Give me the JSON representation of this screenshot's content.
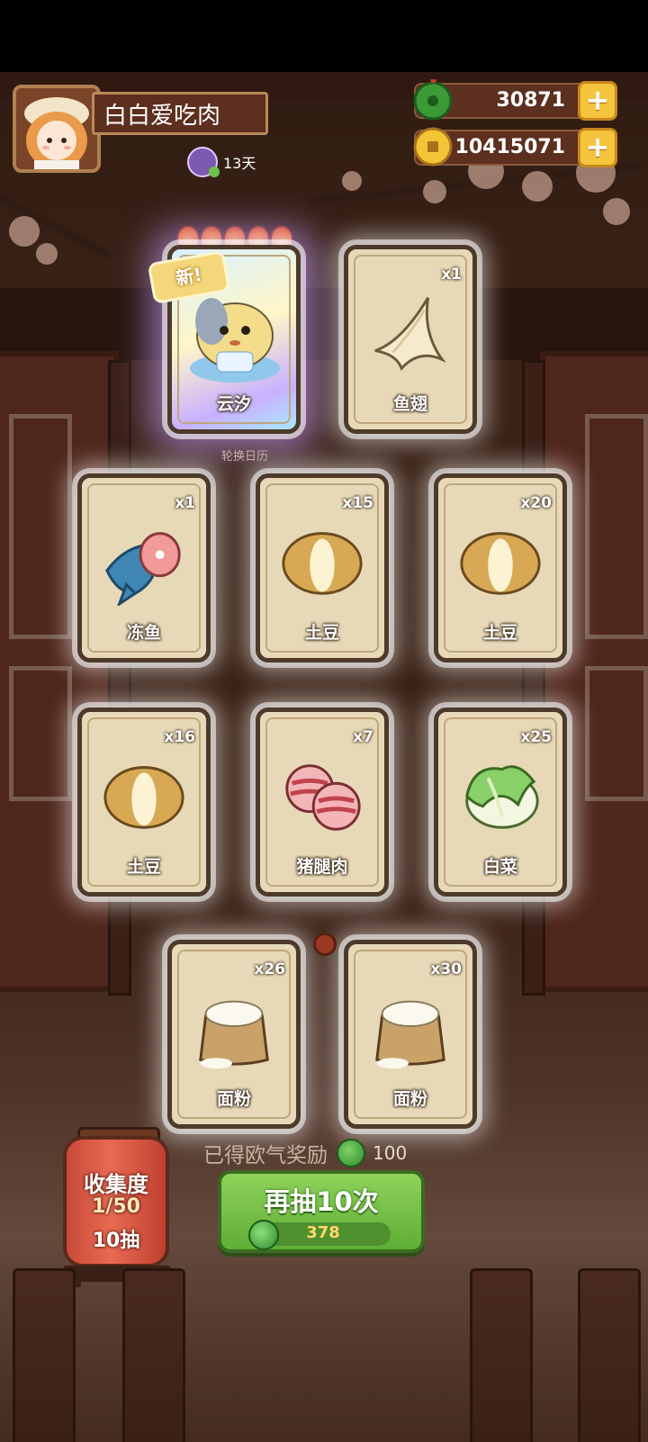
{
  "player": {
    "name": "白白爱吃肉",
    "days": "13天",
    "avatar_icon": "girl-avatar-icon"
  },
  "currencies": {
    "jade": {
      "value": "30871",
      "icon": "jade-icon",
      "add_label": "+"
    },
    "coin": {
      "value": "10415071",
      "icon": "coin-icon",
      "add_label": "+"
    }
  },
  "background_label": "轮换日历",
  "cards": [
    {
      "name": "云汐",
      "qty": "",
      "type": "character",
      "is_new": true,
      "new_label": "新!",
      "stars": 5,
      "icon": "yunxi-character-icon"
    },
    {
      "name": "鱼翅",
      "qty": "x1",
      "type": "ingredient",
      "icon": "shark-fin-icon"
    },
    {
      "name": "冻鱼",
      "qty": "x1",
      "type": "ingredient",
      "icon": "frozen-fish-icon"
    },
    {
      "name": "土豆",
      "qty": "x15",
      "type": "ingredient",
      "icon": "potato-icon"
    },
    {
      "name": "土豆",
      "qty": "x20",
      "type": "ingredient",
      "icon": "potato-icon"
    },
    {
      "name": "土豆",
      "qty": "x16",
      "type": "ingredient",
      "icon": "potato-icon"
    },
    {
      "name": "猪腿肉",
      "qty": "x7",
      "type": "ingredient",
      "icon": "pork-leg-icon"
    },
    {
      "name": "白菜",
      "qty": "x25",
      "type": "ingredient",
      "icon": "cabbage-icon"
    },
    {
      "name": "面粉",
      "qty": "x26",
      "type": "ingredient",
      "icon": "flour-sack-icon"
    },
    {
      "name": "面粉",
      "qty": "x30",
      "type": "ingredient",
      "icon": "flour-sack-icon"
    }
  ],
  "reward": {
    "label": "已得欧气奖励",
    "amount": "100"
  },
  "draw_button": {
    "label": "再抽10次",
    "cost": "378"
  },
  "collection": {
    "title": "收集度",
    "progress": "1/50",
    "draws": "10抽"
  },
  "colors": {
    "button_green": "#6cbf40",
    "plus_gold": "#f4c43c",
    "card_bg": "#e7d9b8"
  }
}
